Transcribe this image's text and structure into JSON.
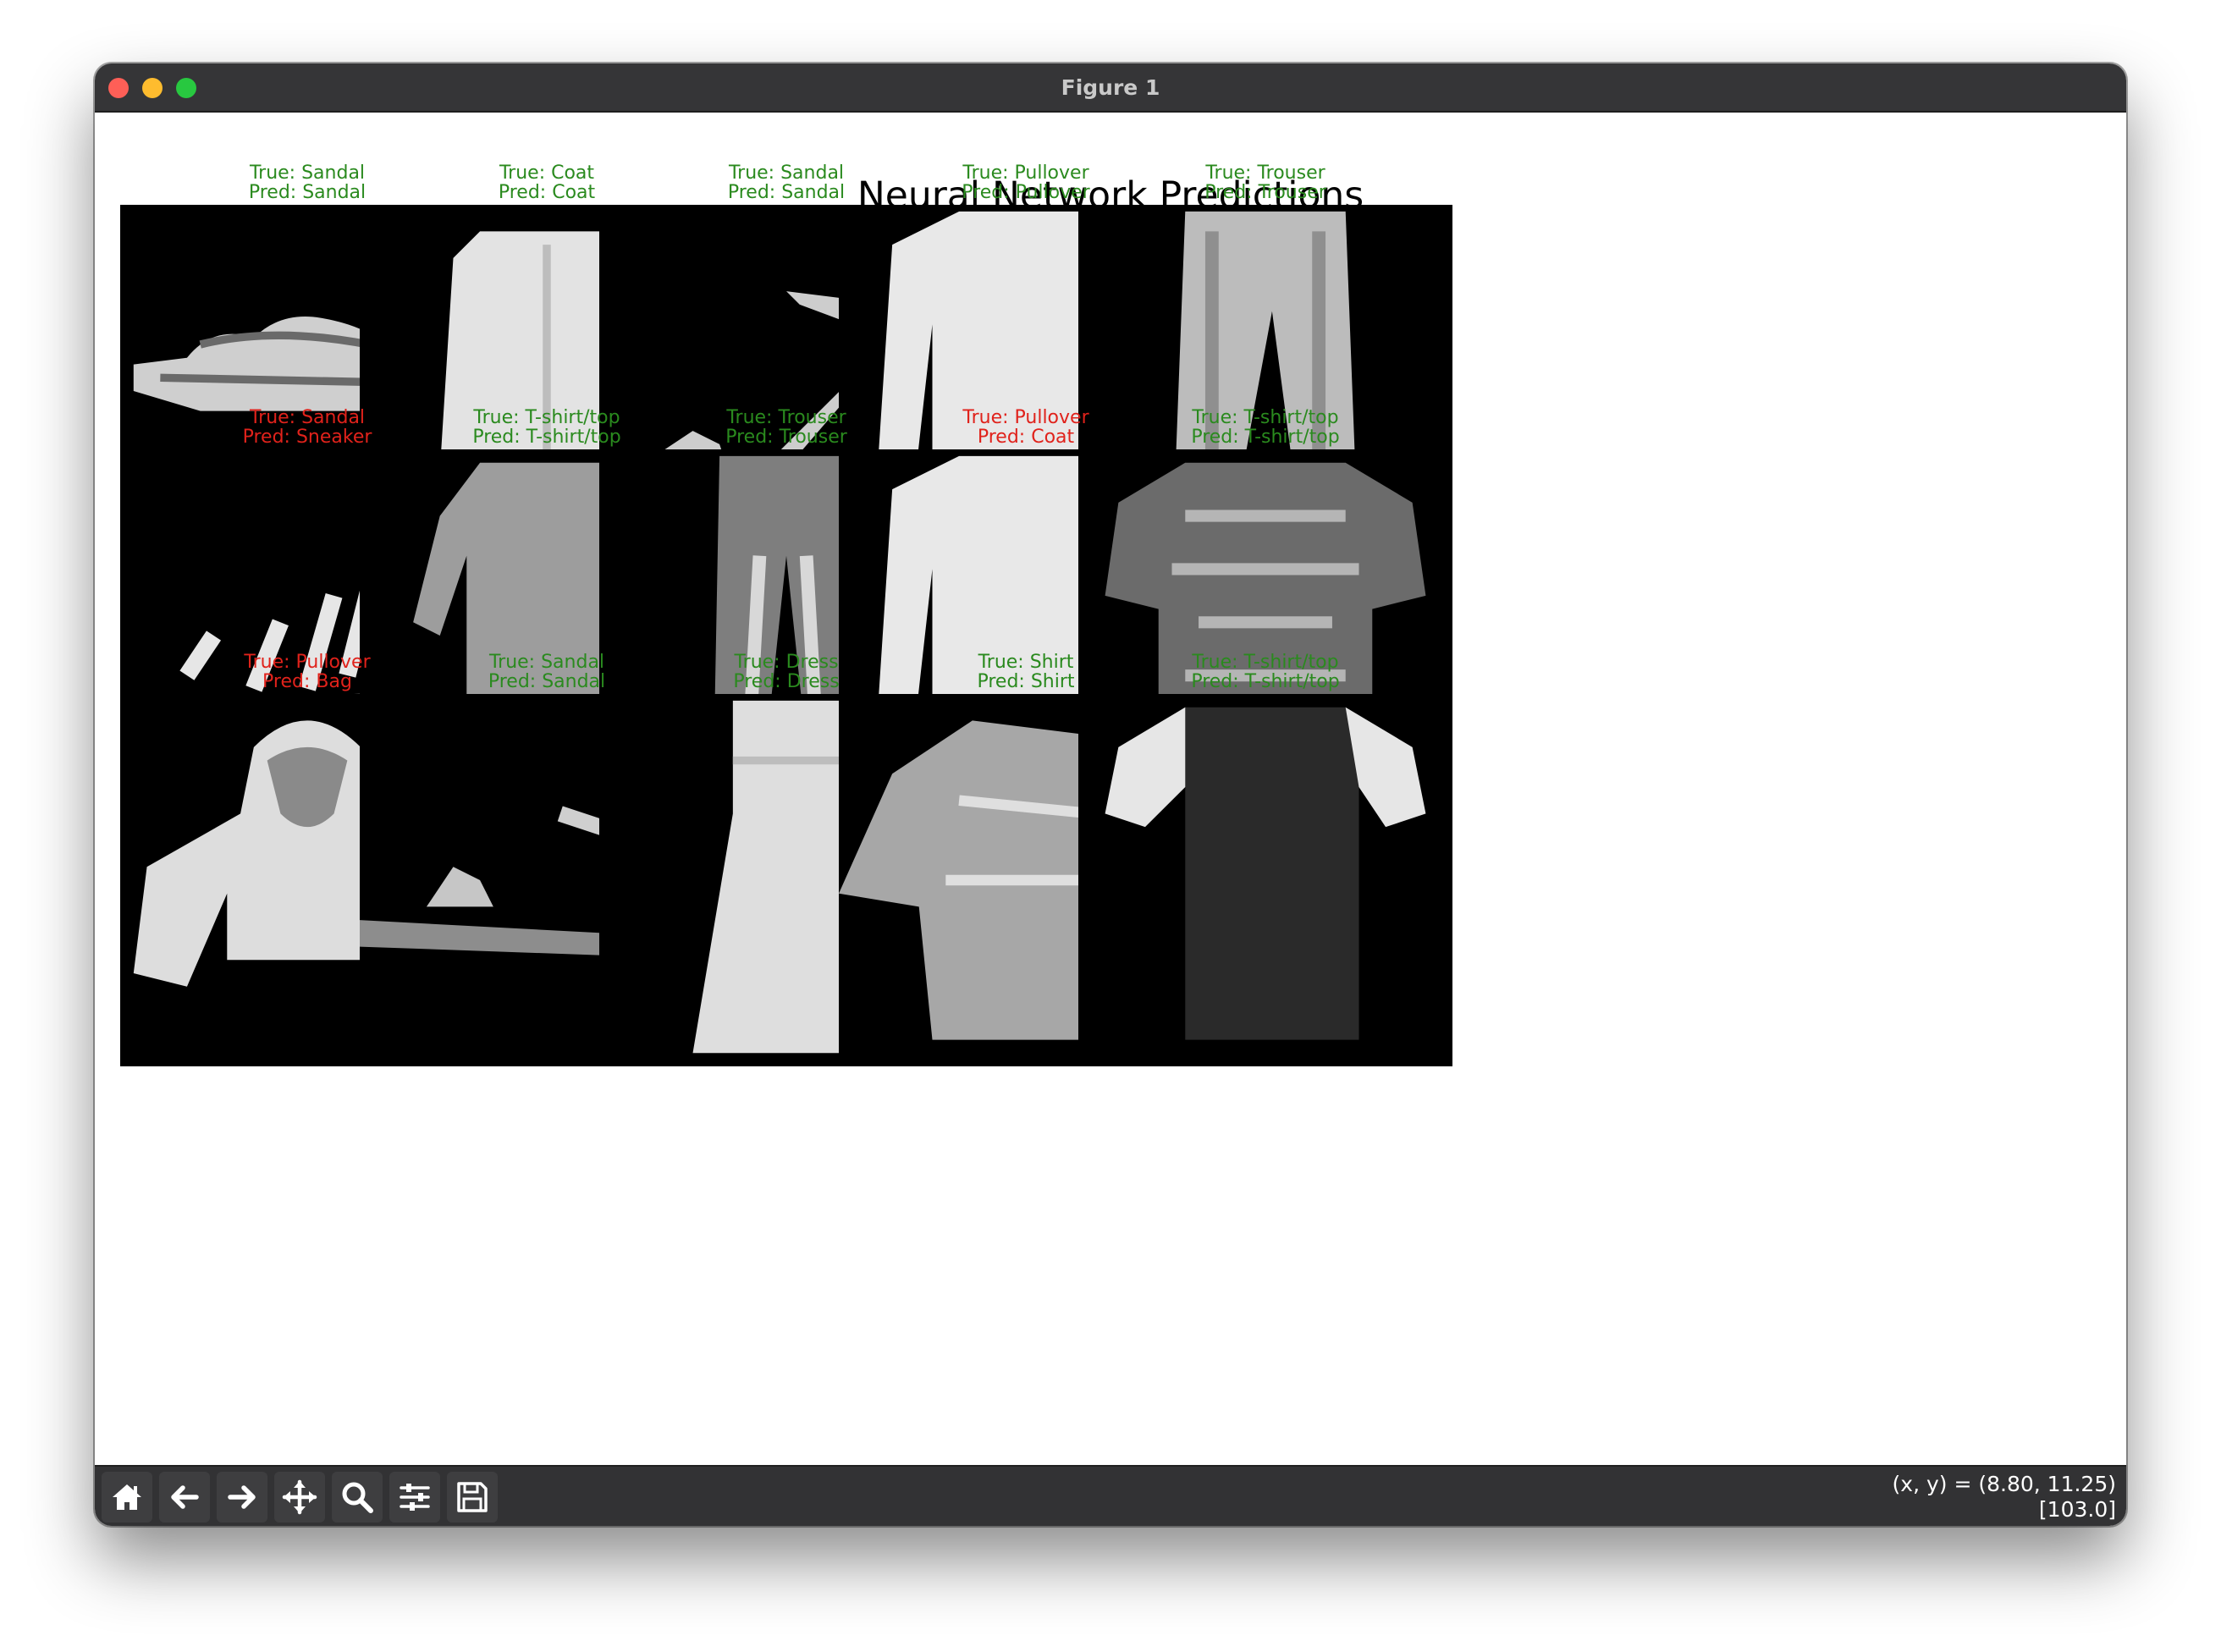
{
  "window": {
    "title": "Figure 1"
  },
  "figure": {
    "title": "Neural Network Predictions"
  },
  "colors": {
    "correct": "#2a8a1e",
    "incorrect": "#e0221b"
  },
  "panels": [
    {
      "true": "True: Sandal",
      "pred": "Pred: Sandal",
      "correct": true,
      "item": "sandal-flat"
    },
    {
      "true": "True: Coat",
      "pred": "Pred: Coat",
      "correct": true,
      "item": "coat"
    },
    {
      "true": "True: Sandal",
      "pred": "Pred: Sandal",
      "correct": true,
      "item": "sandal-heel"
    },
    {
      "true": "True: Pullover",
      "pred": "Pred: Pullover",
      "correct": true,
      "item": "pullover"
    },
    {
      "true": "True: Trouser",
      "pred": "Pred: Trouser",
      "correct": true,
      "item": "trouser"
    },
    {
      "true": "True: Sandal",
      "pred": "Pred: Sneaker",
      "correct": false,
      "item": "sandal-strappy"
    },
    {
      "true": "True: T-shirt/top",
      "pred": "Pred: T-shirt/top",
      "correct": true,
      "item": "bodysuit"
    },
    {
      "true": "True: Trouser",
      "pred": "Pred: Trouser",
      "correct": true,
      "item": "trouser-dark"
    },
    {
      "true": "True: Pullover",
      "pred": "Pred: Coat",
      "correct": false,
      "item": "pullover"
    },
    {
      "true": "True: T-shirt/top",
      "pred": "Pred: T-shirt/top",
      "correct": true,
      "item": "tshirt-pattern"
    },
    {
      "true": "True: Pullover",
      "pred": "Pred: Bag",
      "correct": false,
      "item": "hoodie"
    },
    {
      "true": "True: Sandal",
      "pred": "Pred: Sandal",
      "correct": true,
      "item": "sandal-low"
    },
    {
      "true": "True: Dress",
      "pred": "Pred: Dress",
      "correct": true,
      "item": "dress"
    },
    {
      "true": "True: Shirt",
      "pred": "Pred: Shirt",
      "correct": true,
      "item": "shirt"
    },
    {
      "true": "True: T-shirt/top",
      "pred": "Pred: T-shirt/top",
      "correct": true,
      "item": "tshirt-raglan"
    }
  ],
  "toolbar": {
    "buttons": [
      {
        "name": "home-button",
        "icon": "home-icon"
      },
      {
        "name": "back-button",
        "icon": "arrow-left-icon"
      },
      {
        "name": "forward-button",
        "icon": "arrow-right-icon"
      },
      {
        "name": "pan-button",
        "icon": "move-icon"
      },
      {
        "name": "zoom-button",
        "icon": "magnifier-icon"
      },
      {
        "name": "configure-subplots-button",
        "icon": "sliders-icon"
      },
      {
        "name": "save-button",
        "icon": "floppy-disk-icon"
      }
    ],
    "coords": "(x, y) = (8.80, 11.25)",
    "value": "[103.0]"
  }
}
